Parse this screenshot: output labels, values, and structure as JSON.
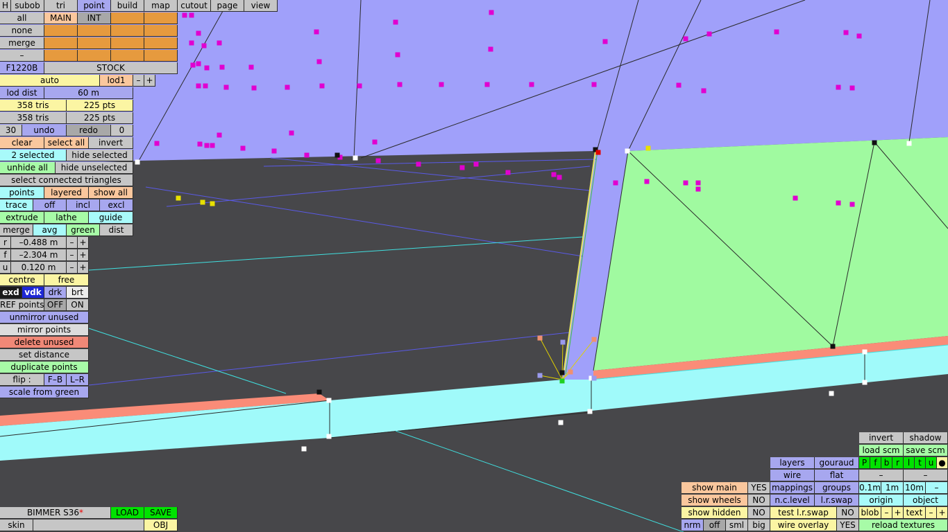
{
  "top_menu": {
    "h": "H",
    "items": [
      "subob",
      "tri",
      "point",
      "build",
      "map",
      "cutout",
      "page",
      "view"
    ],
    "active": "point"
  },
  "sel_block": {
    "rows": [
      "all",
      "none",
      "merge",
      "–"
    ],
    "main": "MAIN",
    "int": "INT"
  },
  "model": {
    "code": "F1220B",
    "variant": "STOCK"
  },
  "lod": {
    "auto": "auto",
    "lod": "lod1",
    "minus": "–",
    "plus": "+",
    "dist_label": "lod dist",
    "dist_value": "60 m"
  },
  "stats": {
    "tris_a": "358 tris",
    "pts_a": "225 pts",
    "tris_b": "358 tris",
    "pts_b": "225 pts"
  },
  "history": {
    "num": "30",
    "undo": "undo",
    "redo": "redo",
    "count": "0"
  },
  "selection": {
    "clear": "clear",
    "select_all": "select all",
    "invert": "invert",
    "selected": "2 selected",
    "hide_selected": "hide selected",
    "unhide_all": "unhide all",
    "hide_unselected": "hide unselected",
    "select_connected": "select connected triangles"
  },
  "modes": {
    "points": "points",
    "layered": "layered",
    "show_all": "show all",
    "trace": "trace",
    "off": "off",
    "incl": "incl",
    "excl": "excl",
    "extrude": "extrude",
    "lathe": "lathe",
    "guide": "guide",
    "merge": "merge",
    "avg": "avg",
    "green": "green",
    "dist": "dist"
  },
  "coords": [
    {
      "axis": "r",
      "value": "–0.488 m"
    },
    {
      "axis": "f",
      "value": "–2.304 m"
    },
    {
      "axis": "u",
      "value": "0.120 m"
    }
  ],
  "pivot": {
    "centre": "centre",
    "free": "free"
  },
  "shade": {
    "exd": "exd",
    "vdk": "vdk",
    "drk": "drk",
    "brt": "brt"
  },
  "ref": {
    "label": "REF points",
    "off": "OFF",
    "on": "ON"
  },
  "actions": {
    "unmirror": "unmirror unused",
    "mirror": "mirror points",
    "delete": "delete unused",
    "set_distance": "set distance",
    "duplicate": "duplicate points",
    "flip": "flip :",
    "fb": "F–B",
    "lr": "L–R",
    "scale": "scale from green"
  },
  "car": {
    "name": "BIMMER S36",
    "star": "*",
    "load": "LOAD",
    "save": "SAVE",
    "skin": "skin",
    "obj": "OBJ"
  },
  "right_panel": {
    "invert": "invert",
    "shadow": "shadow",
    "load_scm": "load scm",
    "save_scm": "save scm",
    "letters": [
      "P",
      "f",
      "b",
      "r",
      "l",
      "t",
      "u",
      "●"
    ],
    "dash": "–",
    "layers": "layers",
    "gouraud": "gouraud",
    "wire": "wire",
    "flat": "flat",
    "mappings": "mappings",
    "groups": "groups",
    "d01": "0.1m",
    "d1": "1m",
    "d10": "10m",
    "show_main": "show main",
    "yes": "YES",
    "show_wheels": "show wheels",
    "no": "NO",
    "nc_level": "n.c.level",
    "lr_swap": "l.r.swap",
    "origin": "origin",
    "object": "object",
    "show_hidden": "show hidden",
    "test_lr": "test l.r.swap",
    "blob": "blob",
    "text": "text",
    "minus": "–",
    "plus": "+",
    "nrm": "nrm",
    "off": "off",
    "sml": "sml",
    "big": "big",
    "wire_overlay": "wire overlay",
    "reload": "reload textures"
  },
  "colors": {
    "sky": "#a0a0fa",
    "green": "#a0faa0",
    "cyan": "#a0fafa",
    "red": "#fa8c78",
    "ground": "#47474a",
    "magenta": "#e000d0"
  }
}
